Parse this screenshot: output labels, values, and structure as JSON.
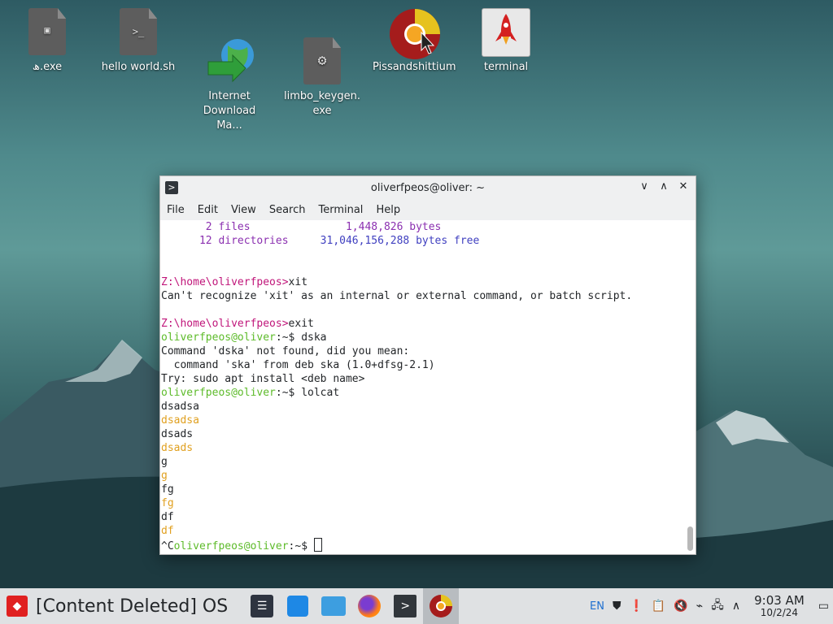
{
  "desktop": {
    "icons": [
      {
        "label": "ھ.exe",
        "glyph": "!"
      },
      {
        "label": "hello world.sh",
        "glyph": ">_"
      },
      {
        "label": "Internet\nDownload Ma...",
        "glyph": ""
      },
      {
        "label": "limbo_keygen.\nexe",
        "glyph": "⚙"
      },
      {
        "label": "Pissandshittium",
        "glyph": ""
      },
      {
        "label": "terminal",
        "glyph": ""
      }
    ]
  },
  "window": {
    "title": "oliverfpeos@oliver: ~",
    "menu": [
      "File",
      "Edit",
      "View",
      "Search",
      "Terminal",
      "Help"
    ],
    "lines": [
      [
        {
          "t": "       2 files               ",
          "c": "c-purple"
        },
        {
          "t": "1,448,826 bytes",
          "c": "c-purple"
        }
      ],
      [
        {
          "t": "      12 directories     ",
          "c": "c-purple"
        },
        {
          "t": "31,046,156,288 bytes free",
          "c": "c-blue"
        }
      ],
      [],
      [],
      [
        {
          "t": "Z:\\home\\oliverfpeos>",
          "c": "c-red"
        },
        {
          "t": "xit",
          "c": ""
        }
      ],
      [
        {
          "t": "Can't recognize 'xit' as an internal or external command, or batch script.",
          "c": ""
        }
      ],
      [],
      [
        {
          "t": "Z:\\home\\oliverfpeos>",
          "c": "c-red"
        },
        {
          "t": "exit",
          "c": ""
        }
      ],
      [
        {
          "t": "oliverfpeos@oliver",
          "c": "c-green"
        },
        {
          "t": ":~$ dska",
          "c": ""
        }
      ],
      [
        {
          "t": "Command 'dska' not found, did you mean:",
          "c": ""
        }
      ],
      [
        {
          "t": "  command 'ska' from deb ska (1.0+dfsg-2.1)",
          "c": ""
        }
      ],
      [
        {
          "t": "Try: sudo apt install <deb name>",
          "c": ""
        }
      ],
      [
        {
          "t": "oliverfpeos@oliver",
          "c": "c-green"
        },
        {
          "t": ":~$ lolcat",
          "c": ""
        }
      ],
      [
        {
          "t": "dsadsa",
          "c": ""
        }
      ],
      [
        {
          "t": "dsadsa",
          "c": "c-orange"
        }
      ],
      [
        {
          "t": "dsads",
          "c": ""
        }
      ],
      [
        {
          "t": "dsads",
          "c": "c-orange"
        }
      ],
      [
        {
          "t": "g",
          "c": ""
        }
      ],
      [
        {
          "t": "g",
          "c": "c-orange"
        }
      ],
      [
        {
          "t": "fg",
          "c": ""
        }
      ],
      [
        {
          "t": "fg",
          "c": "c-orange"
        }
      ],
      [
        {
          "t": "df",
          "c": ""
        }
      ],
      [
        {
          "t": "df",
          "c": "c-orange"
        }
      ],
      [
        {
          "t": "^C",
          "c": ""
        },
        {
          "t": "oliverfpeos@oliver",
          "c": "c-green"
        },
        {
          "t": ":~$ ",
          "c": ""
        }
      ]
    ]
  },
  "taskbar": {
    "start_label": "[Content Deleted] OS",
    "lang": "EN",
    "time": "9:03 AM",
    "date": "10/2/24"
  },
  "colors": {
    "accent_red": "#e02020",
    "prompt_green": "#5dbb2a",
    "dos_prompt": "#c0167a"
  }
}
